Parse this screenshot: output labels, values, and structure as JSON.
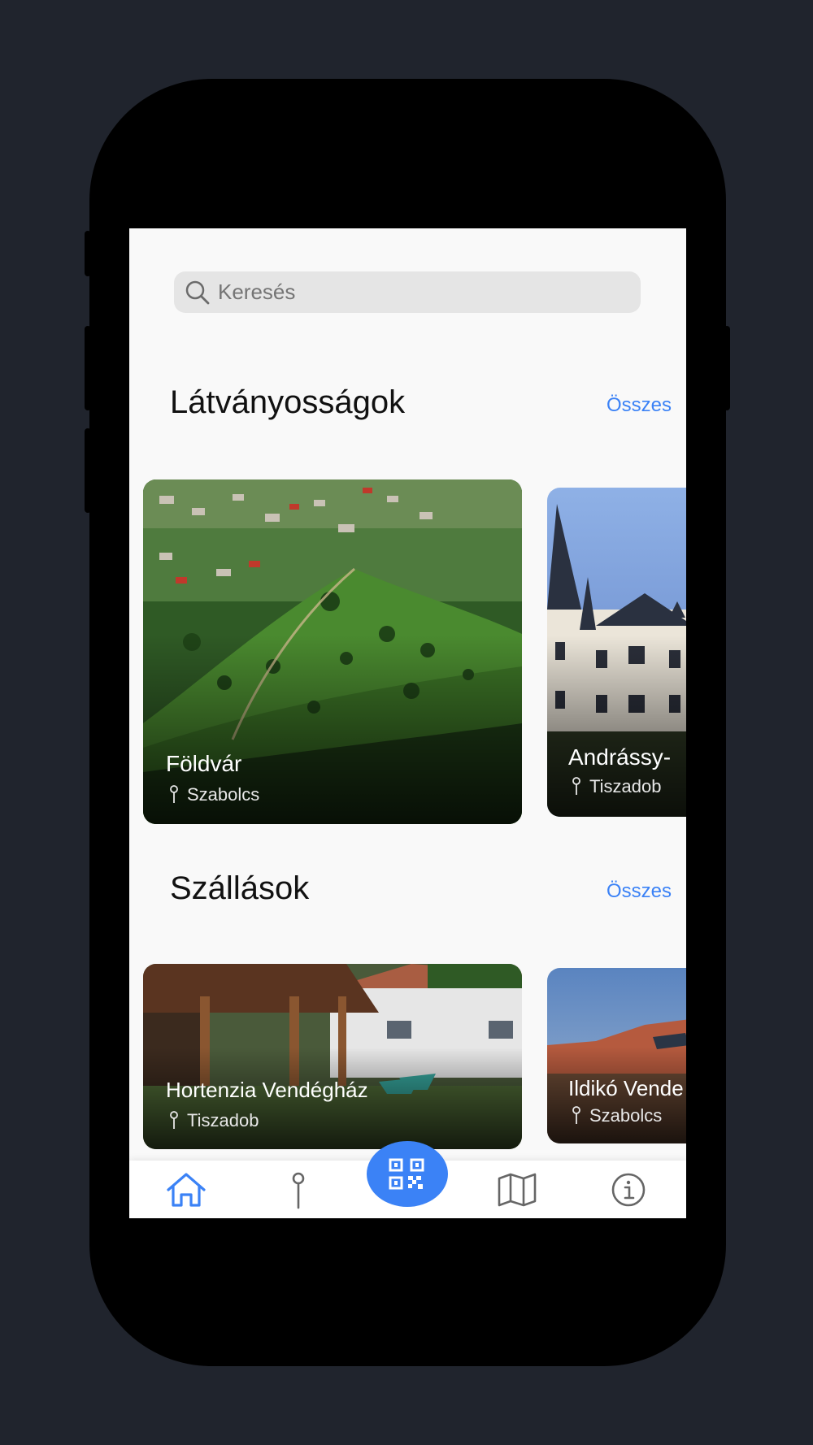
{
  "search": {
    "placeholder": "Keresés"
  },
  "sections": [
    {
      "title": "Látványosságok",
      "see_all": "Összes",
      "cards": [
        {
          "name": "Földvár",
          "location": "Szabolcs"
        },
        {
          "name": "Andrássy-",
          "location": "Tiszadob"
        }
      ]
    },
    {
      "title": "Szállások",
      "see_all": "Összes",
      "cards": [
        {
          "name": "Hortenzia Vendégház",
          "location": "Tiszadob"
        },
        {
          "name": "Ildikó Vende",
          "location": "Szabolcs"
        }
      ]
    }
  ],
  "tabbar": {
    "items": [
      "home-icon",
      "location-pin-icon",
      "qr-code-icon",
      "map-icon",
      "info-icon"
    ],
    "active": "home-icon",
    "accent_color": "#3b82f6"
  }
}
